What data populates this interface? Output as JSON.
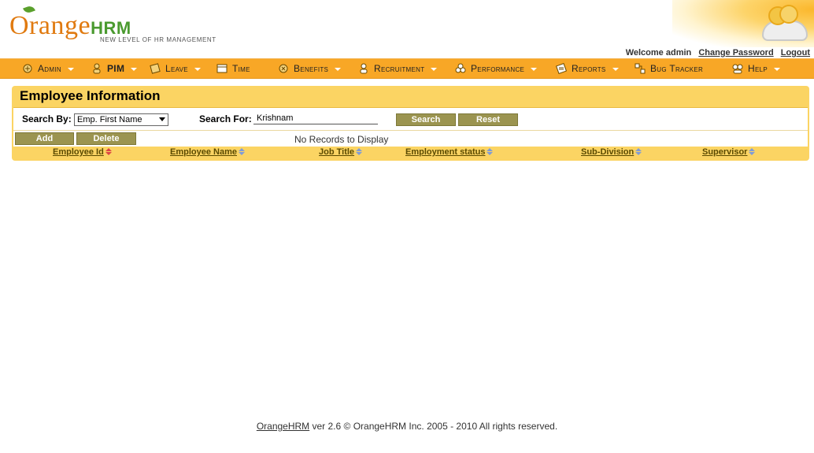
{
  "header": {
    "logo_main": "Orange",
    "logo_hrm": "HRM",
    "tagline": "NEW LEVEL OF HR MANAGEMENT",
    "welcome": "Welcome admin",
    "change_password": "Change Password",
    "logout": "Logout"
  },
  "menu": [
    {
      "label": "Admin",
      "icon": "admin-icon"
    },
    {
      "label": "PIM",
      "icon": "pim-icon"
    },
    {
      "label": "Leave",
      "icon": "leave-icon"
    },
    {
      "label": "Time",
      "icon": "time-icon"
    },
    {
      "label": "Benefits",
      "icon": "benefits-icon"
    },
    {
      "label": "Recruitment",
      "icon": "recruitment-icon"
    },
    {
      "label": "Performance",
      "icon": "performance-icon"
    },
    {
      "label": "Reports",
      "icon": "reports-icon"
    },
    {
      "label": "Bug Tracker",
      "icon": "bug-tracker-icon"
    },
    {
      "label": "Help",
      "icon": "help-icon"
    }
  ],
  "page": {
    "title": "Employee Information",
    "search_by_label": "Search By:",
    "search_by_value": "Emp. First Name",
    "search_for_label": "Search For:",
    "search_for_value": "Krishnam",
    "search_button": "Search",
    "reset_button": "Reset",
    "add_button": "Add",
    "delete_button": "Delete",
    "no_records": "No Records to Display"
  },
  "table": {
    "columns": [
      "Employee Id",
      "Employee Name",
      "Job Title",
      "Employment status",
      "Sub-Division",
      "Supervisor"
    ],
    "sorted_column": "Employee Id",
    "rows": []
  },
  "footer": {
    "link": "OrangeHRM",
    "text": " ver 2.6 © OrangeHRM Inc. 2005 - 2010 All rights reserved."
  },
  "colors": {
    "menu_bar": "#f8a726",
    "panel": "#fbd463",
    "button": "#9b9450"
  }
}
